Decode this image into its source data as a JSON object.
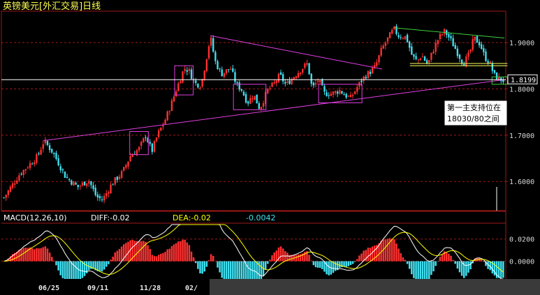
{
  "title": "英镑美元[外汇交易]日线",
  "colors": {
    "background": "#000000",
    "up_candle": "#ff3030",
    "down_candle": "#40e0f0",
    "price_box": "#ffffff",
    "trend_pink": "#e040e0",
    "trend_green": "#40d040",
    "support_yellow": "#ffff60",
    "gridline": "#a01818",
    "axis_text": "#d8d8d8",
    "macd_dif": "#ffffff",
    "macd_dea": "#ffff00"
  },
  "current_price_label": "1.8199",
  "annotation": {
    "line1": "第一主支持位在",
    "line2": "18030/80之间"
  },
  "macd": {
    "label": "MACD(12,26,10)",
    "diff_label": "DIFF:-0.02",
    "dea_label": "DEA:-0.02",
    "macd_value": "-0.0042"
  },
  "chart_data": [
    {
      "type": "candlestick",
      "title": "英镑美元[外汇交易]日线",
      "y_ticks": [
        "1.9000",
        "1.8000",
        "1.7000",
        "1.6000"
      ],
      "y_tick_values": [
        1.9,
        1.8,
        1.7,
        1.6
      ],
      "ylim": [
        1.54,
        1.965
      ],
      "x_ticks": [
        "06/25",
        "09/11",
        "11/28",
        "02/"
      ],
      "n_bars": 230,
      "current_price": 1.8199,
      "grid": true,
      "price_path": [
        [
          0,
          1.565
        ],
        [
          10,
          1.615
        ],
        [
          22,
          1.655
        ],
        [
          26,
          1.688
        ],
        [
          32,
          1.662
        ],
        [
          40,
          1.61
        ],
        [
          48,
          1.588
        ],
        [
          55,
          1.603
        ],
        [
          60,
          1.567
        ],
        [
          64,
          1.56
        ],
        [
          70,
          1.595
        ],
        [
          77,
          1.62
        ],
        [
          82,
          1.655
        ],
        [
          88,
          1.672
        ],
        [
          92,
          1.7
        ],
        [
          96,
          1.665
        ],
        [
          100,
          1.703
        ],
        [
          104,
          1.728
        ],
        [
          108,
          1.762
        ],
        [
          112,
          1.8
        ],
        [
          117,
          1.845
        ],
        [
          120,
          1.84
        ],
        [
          124,
          1.812
        ],
        [
          128,
          1.808
        ],
        [
          132,
          1.877
        ],
        [
          134,
          1.913
        ],
        [
          137,
          1.86
        ],
        [
          141,
          1.832
        ],
        [
          147,
          1.845
        ],
        [
          151,
          1.808
        ],
        [
          154,
          1.8
        ],
        [
          158,
          1.77
        ],
        [
          162,
          1.788
        ],
        [
          166,
          1.757
        ],
        [
          171,
          1.797
        ],
        [
          175,
          1.81
        ],
        [
          179,
          1.83
        ],
        [
          183,
          1.808
        ],
        [
          187,
          1.823
        ],
        [
          192,
          1.84
        ],
        [
          197,
          1.855
        ],
        [
          200,
          1.8
        ],
        [
          204,
          1.82
        ],
        [
          208,
          1.79
        ],
        [
          213,
          1.79
        ],
        [
          218,
          1.797
        ],
        [
          221,
          1.787
        ],
        [
          225,
          1.78
        ],
        [
          230,
          1.808
        ],
        [
          234,
          1.827
        ],
        [
          238,
          1.838
        ],
        [
          241,
          1.848
        ],
        [
          245,
          1.885
        ],
        [
          249,
          1.908
        ],
        [
          253,
          1.93
        ],
        [
          256,
          1.915
        ],
        [
          261,
          1.912
        ],
        [
          265,
          1.87
        ],
        [
          268,
          1.86
        ],
        [
          271,
          1.873
        ],
        [
          275,
          1.852
        ],
        [
          278,
          1.88
        ],
        [
          282,
          1.91
        ],
        [
          286,
          1.925
        ],
        [
          290,
          1.905
        ],
        [
          294,
          1.88
        ],
        [
          298,
          1.855
        ],
        [
          302,
          1.875
        ],
        [
          305,
          1.91
        ],
        [
          309,
          1.897
        ],
        [
          312,
          1.868
        ],
        [
          315,
          1.858
        ],
        [
          318,
          1.83
        ],
        [
          321,
          1.822
        ],
        [
          324,
          1.818
        ]
      ]
    },
    {
      "type": "macd",
      "label": "MACD(12,26,10)",
      "diff": -0.02,
      "dea": -0.02,
      "macd": -0.0042,
      "y_ticks": [
        "0.0200",
        "0.0000"
      ],
      "y_tick_values": [
        0.02,
        0.0
      ],
      "ylim": [
        -0.016,
        0.033
      ]
    }
  ]
}
